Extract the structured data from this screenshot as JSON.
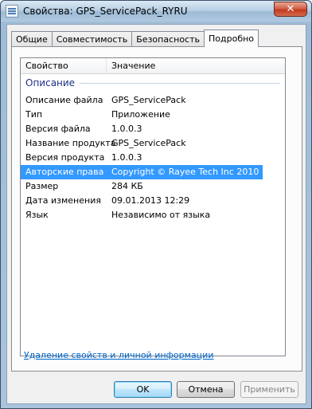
{
  "window": {
    "title": "Свойства: GPS_ServicePack_RYRU",
    "close_label": "✕"
  },
  "tabs": [
    {
      "label": "Общие"
    },
    {
      "label": "Совместимость"
    },
    {
      "label": "Безопасность"
    },
    {
      "label": "Подробно"
    }
  ],
  "active_tab": "Подробно",
  "list": {
    "headers": {
      "property": "Свойство",
      "value": "Значение"
    },
    "group": "Описание",
    "rows": [
      {
        "key": "Описание файла",
        "value": "GPS_ServicePack"
      },
      {
        "key": "Тип",
        "value": "Приложение"
      },
      {
        "key": "Версия файла",
        "value": "1.0.0.3"
      },
      {
        "key": "Название продукта",
        "value": "GPS_ServicePack"
      },
      {
        "key": "Версия продукта",
        "value": "1.0.0.3"
      },
      {
        "key": "Авторские права",
        "value": "Copyright © Rayee Tech Inc 2010"
      },
      {
        "key": "Размер",
        "value": "284 КБ"
      },
      {
        "key": "Дата изменения",
        "value": "09.01.2013 12:29"
      },
      {
        "key": "Язык",
        "value": "Независимо от языка"
      }
    ],
    "selected_row": "Авторские права"
  },
  "link_remove_properties": "Удаление свойств и личной информации",
  "buttons": {
    "ok": "OK",
    "cancel": "Отмена",
    "apply": "Применить"
  },
  "colors": {
    "selection": "#3399ff",
    "group_text": "#1e3287",
    "link": "#0066cc"
  }
}
